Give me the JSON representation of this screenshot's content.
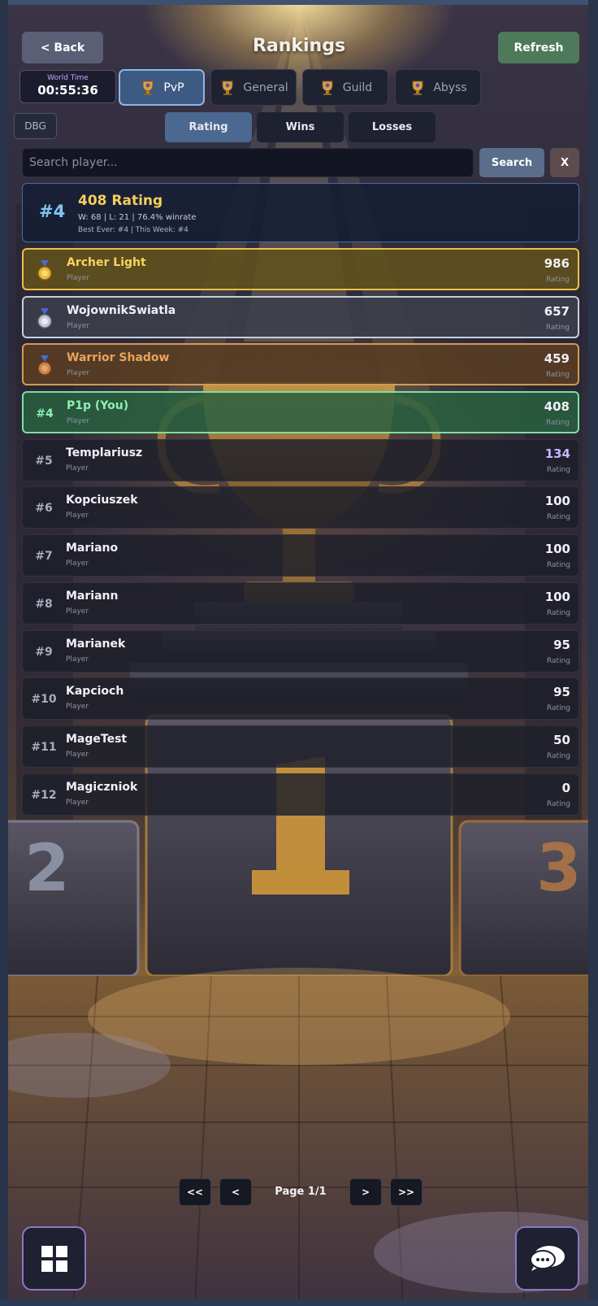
{
  "header": {
    "back_label": "< Back",
    "title": "Rankings",
    "refresh_label": "Refresh"
  },
  "world_time": {
    "label": "World Time",
    "value": "00:55:36"
  },
  "category_tabs": [
    {
      "label": "PvP",
      "icon": "trophy-icon",
      "active": true
    },
    {
      "label": "General",
      "icon": "trophy-icon",
      "active": false
    },
    {
      "label": "Guild",
      "icon": "trophy-icon",
      "active": false
    },
    {
      "label": "Abyss",
      "icon": "trophy-icon",
      "active": false
    }
  ],
  "debug_label": "DBG",
  "sort_tabs": [
    {
      "label": "Rating",
      "active": true
    },
    {
      "label": "Wins",
      "active": false
    },
    {
      "label": "Losses",
      "active": false
    }
  ],
  "search": {
    "placeholder": "Search player...",
    "button_label": "Search",
    "clear_label": "X"
  },
  "my_rank": {
    "rank": "#4",
    "rating": "408 Rating",
    "stats": "W: 68 | L: 21 | 76.4% winrate",
    "best": "Best Ever: #4 | This Week: #4"
  },
  "rankings": [
    {
      "pos": "",
      "medal": "gold-medal-icon",
      "name": "Archer Light",
      "sub": "Player",
      "value": "986",
      "value_label": "Rating",
      "style": "gold"
    },
    {
      "pos": "",
      "medal": "silver-medal-icon",
      "name": "WojownikSwiatla",
      "sub": "Player",
      "value": "657",
      "value_label": "Rating",
      "style": "silver"
    },
    {
      "pos": "",
      "medal": "bronze-medal-icon",
      "name": "Warrior Shadow",
      "sub": "Player",
      "value": "459",
      "value_label": "Rating",
      "style": "bronze"
    },
    {
      "pos": "#4",
      "name": "P1p (You)",
      "sub": "Player",
      "value": "408",
      "value_label": "Rating",
      "style": "me"
    },
    {
      "pos": "#5",
      "name": "Templariusz",
      "sub": "Player",
      "value": "134",
      "value_label": "Rating",
      "style": "purple"
    },
    {
      "pos": "#6",
      "name": "Kopciuszek",
      "sub": "Player",
      "value": "100",
      "value_label": "Rating",
      "style": ""
    },
    {
      "pos": "#7",
      "name": "Mariano",
      "sub": "Player",
      "value": "100",
      "value_label": "Rating",
      "style": ""
    },
    {
      "pos": "#8",
      "name": "Mariann",
      "sub": "Player",
      "value": "100",
      "value_label": "Rating",
      "style": ""
    },
    {
      "pos": "#9",
      "name": "Marianek",
      "sub": "Player",
      "value": "95",
      "value_label": "Rating",
      "style": ""
    },
    {
      "pos": "#10",
      "name": "Kapcioch",
      "sub": "Player",
      "value": "95",
      "value_label": "Rating",
      "style": ""
    },
    {
      "pos": "#11",
      "name": "MageTest",
      "sub": "Player",
      "value": "50",
      "value_label": "Rating",
      "style": ""
    },
    {
      "pos": "#12",
      "name": "Magiczniok",
      "sub": "Player",
      "value": "0",
      "value_label": "Rating",
      "style": ""
    }
  ],
  "pagination": {
    "first": "<<",
    "prev": "<",
    "label": "Page 1/1",
    "next": ">",
    "last": ">>"
  },
  "colors": {
    "gold": "#e7c24a",
    "silver": "#c7cddd",
    "bronze": "#d39a52",
    "me": "#7ce0a0",
    "accent": "#4a6890"
  }
}
